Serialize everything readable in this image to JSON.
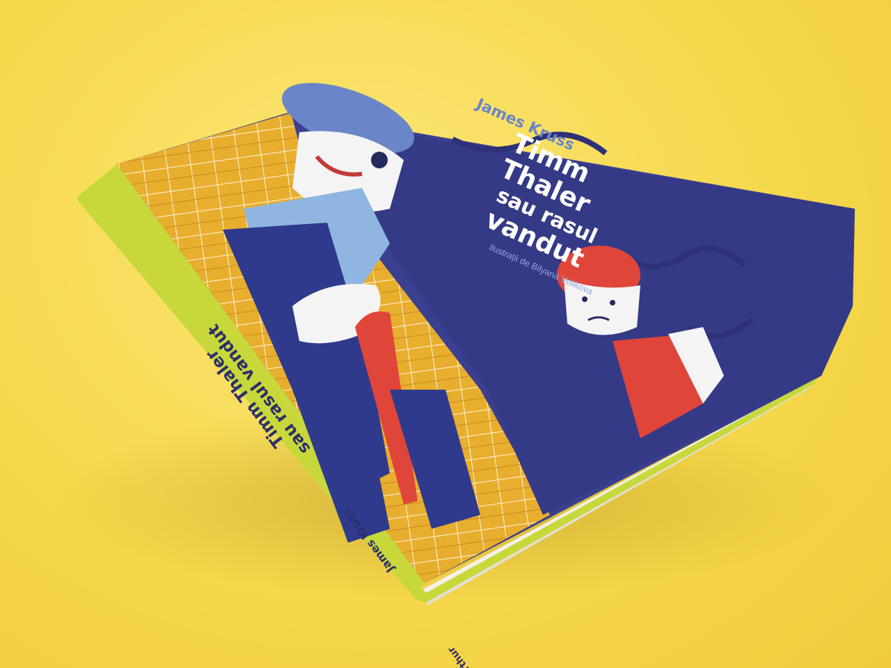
{
  "book": {
    "author": "James Kruss",
    "title_lines": [
      "Timm",
      "Thaler",
      "sau rasul",
      "vandut"
    ],
    "illustrator_credit": "Ilustrații de Bilyana Velikova",
    "spine_title_line1": "Timm Thaler",
    "spine_title_line2": "sau rasul vandut",
    "spine_author": "James Kruss",
    "spine_publisher": "Arthur"
  },
  "colors": {
    "background": "#f6d84c",
    "cover_navy": "#3b3f8f",
    "plaid_yellow": "#e8ae2e",
    "spine_green": "#c8d83a",
    "cane_red": "#e0453a",
    "shirt_blue": "#8fb6e0"
  }
}
